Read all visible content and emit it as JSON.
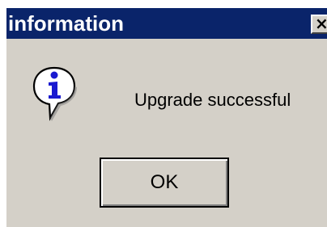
{
  "window": {
    "title": "information",
    "close_glyph": "×",
    "close_icon": "close-icon"
  },
  "content": {
    "icon": "information-icon",
    "message": "Upgrade successful"
  },
  "buttons": {
    "ok_label": "OK"
  },
  "colors": {
    "title_bar": "#0a246a",
    "dialog_background": "#d4d0c8",
    "icon_blue": "#1a1ad0"
  }
}
